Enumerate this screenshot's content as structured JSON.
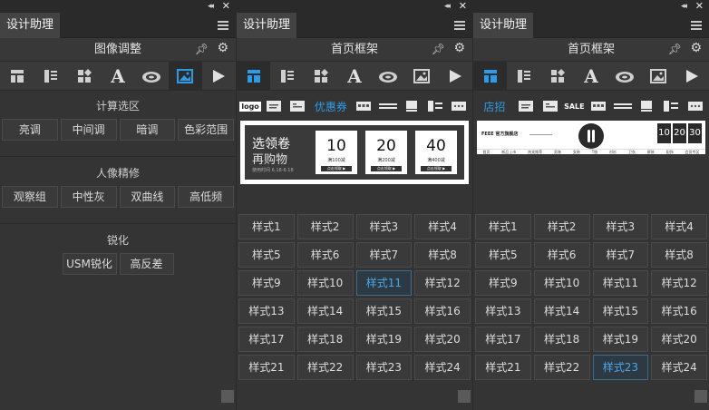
{
  "panels": [
    {
      "tab": "设计助理",
      "header": "图像调整",
      "sections": [
        {
          "title": "计算选区",
          "buttons": [
            "亮调",
            "中间调",
            "暗调",
            "色彩范围"
          ]
        },
        {
          "title": "人像精修",
          "buttons": [
            "观察组",
            "中性灰",
            "双曲线",
            "高低频"
          ]
        },
        {
          "title": "锐化",
          "buttons": [
            "USM锐化",
            "高反差"
          ]
        }
      ]
    },
    {
      "tab": "设计助理",
      "header": "首页框架",
      "subicons": [
        "logo",
        "",
        "",
        "优惠券",
        "",
        "",
        "",
        "",
        ""
      ],
      "coupon": {
        "title": "选领卷",
        "subtitle": "再购物",
        "note": "使用时间 6.18-6.18",
        "cards": [
          {
            "value": "10",
            "cond": "满100减",
            "btn": "点击领取 ▶"
          },
          {
            "value": "20",
            "cond": "满200减",
            "btn": "点击领取 ▶"
          },
          {
            "value": "40",
            "cond": "满400减",
            "btn": "点击领取 ▶"
          }
        ]
      },
      "styles": [
        "样式1",
        "样式2",
        "样式3",
        "样式4",
        "样式5",
        "样式6",
        "样式7",
        "样式8",
        "样式9",
        "样式10",
        "样式11",
        "样式12",
        "样式13",
        "样式14",
        "样式15",
        "样式16",
        "样式17",
        "样式18",
        "样式19",
        "样式20",
        "样式21",
        "样式22",
        "样式23",
        "样式24"
      ],
      "active_style": 10
    },
    {
      "tab": "设计助理",
      "header": "首页框架",
      "subicons": [
        "店招",
        "",
        "",
        "SALE",
        "",
        "",
        "",
        "",
        ""
      ],
      "banner": {
        "shop": "FEEE 官方旗舰店",
        "nums": [
          "10",
          "20",
          "30"
        ],
        "nav": [
          "首页",
          "新品上市",
          "热卖推荐",
          "男装",
          "女装",
          "T恤",
          "衬衫",
          "卫衣",
          "裤装",
          "配饰",
          "会员专区"
        ]
      },
      "styles": [
        "样式1",
        "样式2",
        "样式3",
        "样式4",
        "样式5",
        "样式6",
        "样式7",
        "样式8",
        "样式9",
        "样式10",
        "样式11",
        "样式12",
        "样式13",
        "样式14",
        "样式15",
        "样式16",
        "样式17",
        "样式18",
        "样式19",
        "样式20",
        "样式21",
        "样式22",
        "样式23",
        "样式24"
      ],
      "active_style": 22
    }
  ],
  "icons": [
    "layout-icon",
    "list-icon",
    "shapes-icon",
    "type-icon",
    "creative-cloud-icon",
    "image-icon",
    "play-icon"
  ],
  "colors": {
    "accent": "#2d9ce8",
    "panel": "#343434",
    "dark": "#2a2a2a"
  }
}
